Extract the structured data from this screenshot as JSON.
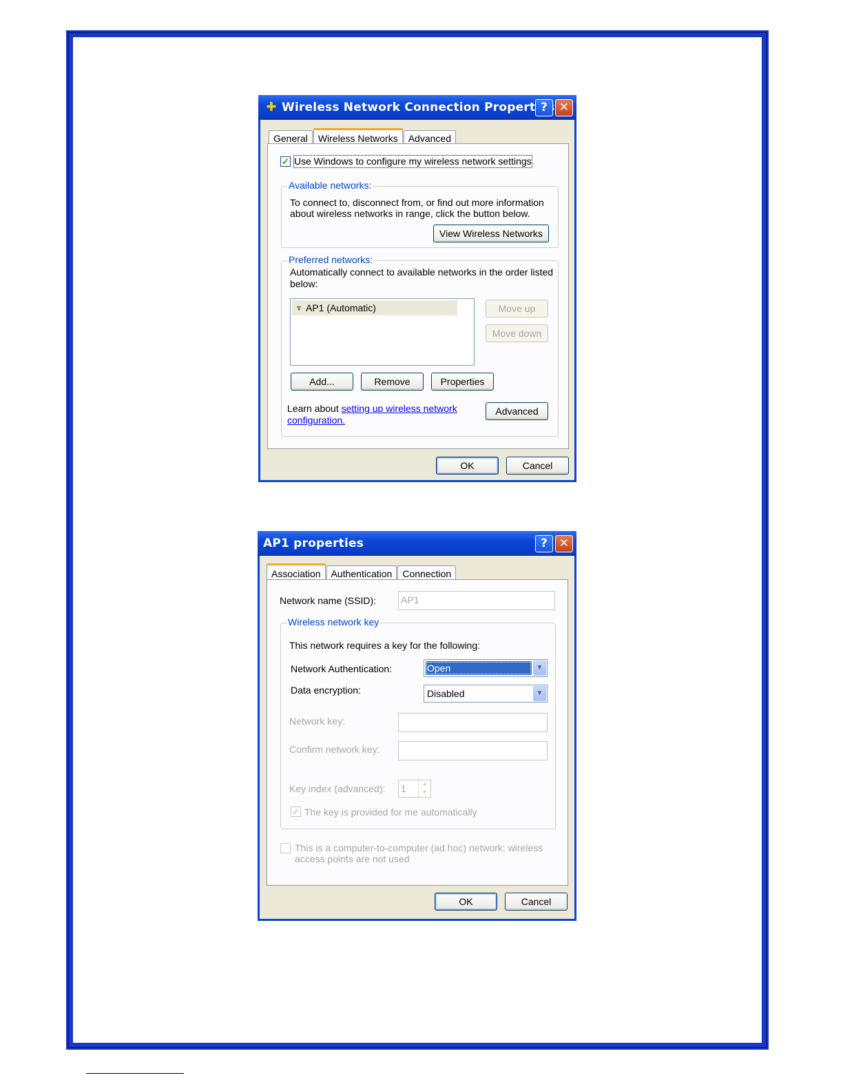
{
  "dialog1": {
    "title": "Wireless Network Connection Properties",
    "help_glyph": "?",
    "close_glyph": "✕",
    "tabs": [
      "General",
      "Wireless Networks",
      "Advanced"
    ],
    "active_tab": "Wireless Networks",
    "use_windows_checkbox": {
      "checked": true,
      "label": "Use Windows to configure my wireless network settings"
    },
    "available_networks": {
      "legend": "Available networks:",
      "description_line1": "To connect to, disconnect from, or find out more information",
      "description_line2": "about wireless networks in range, click the button below.",
      "view_button": "View Wireless Networks"
    },
    "preferred_networks": {
      "legend": "Preferred networks:",
      "description_line1": "Automatically connect to available networks in the order listed",
      "description_line2": "below:",
      "list_items": [
        "AP1 (Automatic)"
      ],
      "list_item_icon": "antenna-icon",
      "move_up": "Move up",
      "move_down": "Move down",
      "add": "Add...",
      "remove": "Remove",
      "properties": "Properties",
      "learn_prefix": "Learn about ",
      "learn_link1": "setting up wireless network",
      "learn_link2": "configuration.",
      "advanced_button": "Advanced"
    },
    "ok": "OK",
    "cancel": "Cancel"
  },
  "dialog2": {
    "title": "AP1 properties",
    "help_glyph": "?",
    "close_glyph": "✕",
    "tabs": [
      "Association",
      "Authentication",
      "Connection"
    ],
    "active_tab": "Association",
    "ssid_label": "Network name (SSID):",
    "ssid_value": "AP1",
    "wireless_key": {
      "legend": "Wireless network key",
      "requires_text": "This network requires a key for the following:",
      "auth_label": "Network Authentication:",
      "auth_value": "Open",
      "encryption_label": "Data encryption:",
      "encryption_value": "Disabled",
      "network_key_label": "Network key:",
      "confirm_key_label": "Confirm network key:",
      "key_index_label": "Key index (advanced):",
      "key_index_value": "1",
      "auto_key_checkbox": {
        "checked": true,
        "label": "The key is provided for me automatically"
      }
    },
    "adhoc_checkbox": {
      "checked": false,
      "label_line1": "This is a computer-to-computer (ad hoc) network; wireless",
      "label_line2": "access points are not used"
    },
    "ok": "OK",
    "cancel": "Cancel"
  },
  "colors": {
    "page_border": "#1a38c8",
    "xp_titlebar": "#0a46d6",
    "xp_dialog_bg": "#ece9d8",
    "groupbox_legend": "#0046d5",
    "selection": "#316ac5"
  }
}
